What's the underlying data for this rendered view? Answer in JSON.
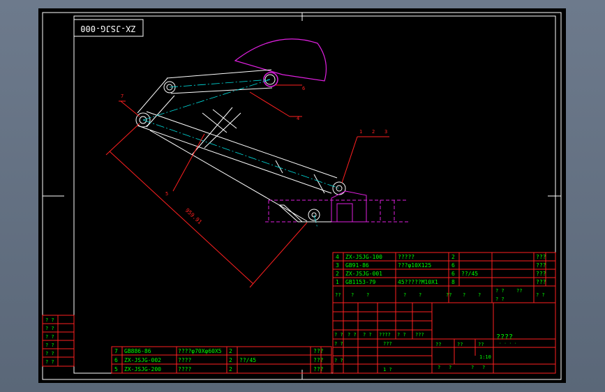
{
  "drawing": {
    "title_block_text": "ZX-JSJG-000",
    "callouts": {
      "c7": "7",
      "c6": "6",
      "c4": "4",
      "c5": "5",
      "c1": "1",
      "c2": "2",
      "c3": "3"
    },
    "dimension_value": "959.91"
  },
  "left_column": {
    "cells": [
      "? ?",
      "? ?",
      "? ?",
      "? ?",
      "? ?",
      "? ?"
    ]
  },
  "bottom_bom": {
    "rows": [
      {
        "no": "7",
        "code": "GB886-86",
        "name": "????φ70Xφ60X5",
        "qty": "2",
        "mat": "",
        "note": "???"
      },
      {
        "no": "6",
        "code": "ZX-JSJG-002",
        "name": "????",
        "qty": "2",
        "mat": "??/45",
        "note": "???"
      },
      {
        "no": "5",
        "code": "ZX-JSJG-200",
        "name": "????",
        "qty": "2",
        "mat": "",
        "note": "???"
      }
    ]
  },
  "right_bom": {
    "rows": [
      {
        "no": "4",
        "code": "ZX-JSJG-100",
        "name": "?????",
        "qty": "2",
        "note": "???"
      },
      {
        "no": "3",
        "code": "GB91-86",
        "name": "???φ10X125",
        "qty": "6",
        "note": "???"
      },
      {
        "no": "2",
        "code": "ZX-JSJG-001",
        "name": "",
        "qty": "6",
        "mat": "??/45",
        "note": "???"
      },
      {
        "no": "1",
        "code": "GB1153-79",
        "name": "45?????M10X1",
        "qty": "8",
        "note": "???"
      }
    ],
    "header": {
      "a": "??",
      "b": "?",
      "c": "?",
      "d": "?",
      "e": "?",
      "f": "??",
      "g": "?",
      "h": "?",
      "i": "? ?",
      "j": "??",
      "k": "? ?",
      "l": "? ?"
    }
  },
  "title_block": {
    "name": "????",
    "sub": "· · · ·",
    "row1": [
      "? ?",
      "? ?",
      "? ?",
      "????",
      "? ?",
      "???"
    ],
    "row2": [
      "? ?",
      "???"
    ],
    "row3": [
      "? ?"
    ],
    "row4": [
      "1 ?"
    ],
    "scale_labels": [
      "??",
      "??",
      "??"
    ],
    "scale": "1:10",
    "sheet": [
      "?",
      "?",
      "?",
      "?"
    ]
  }
}
